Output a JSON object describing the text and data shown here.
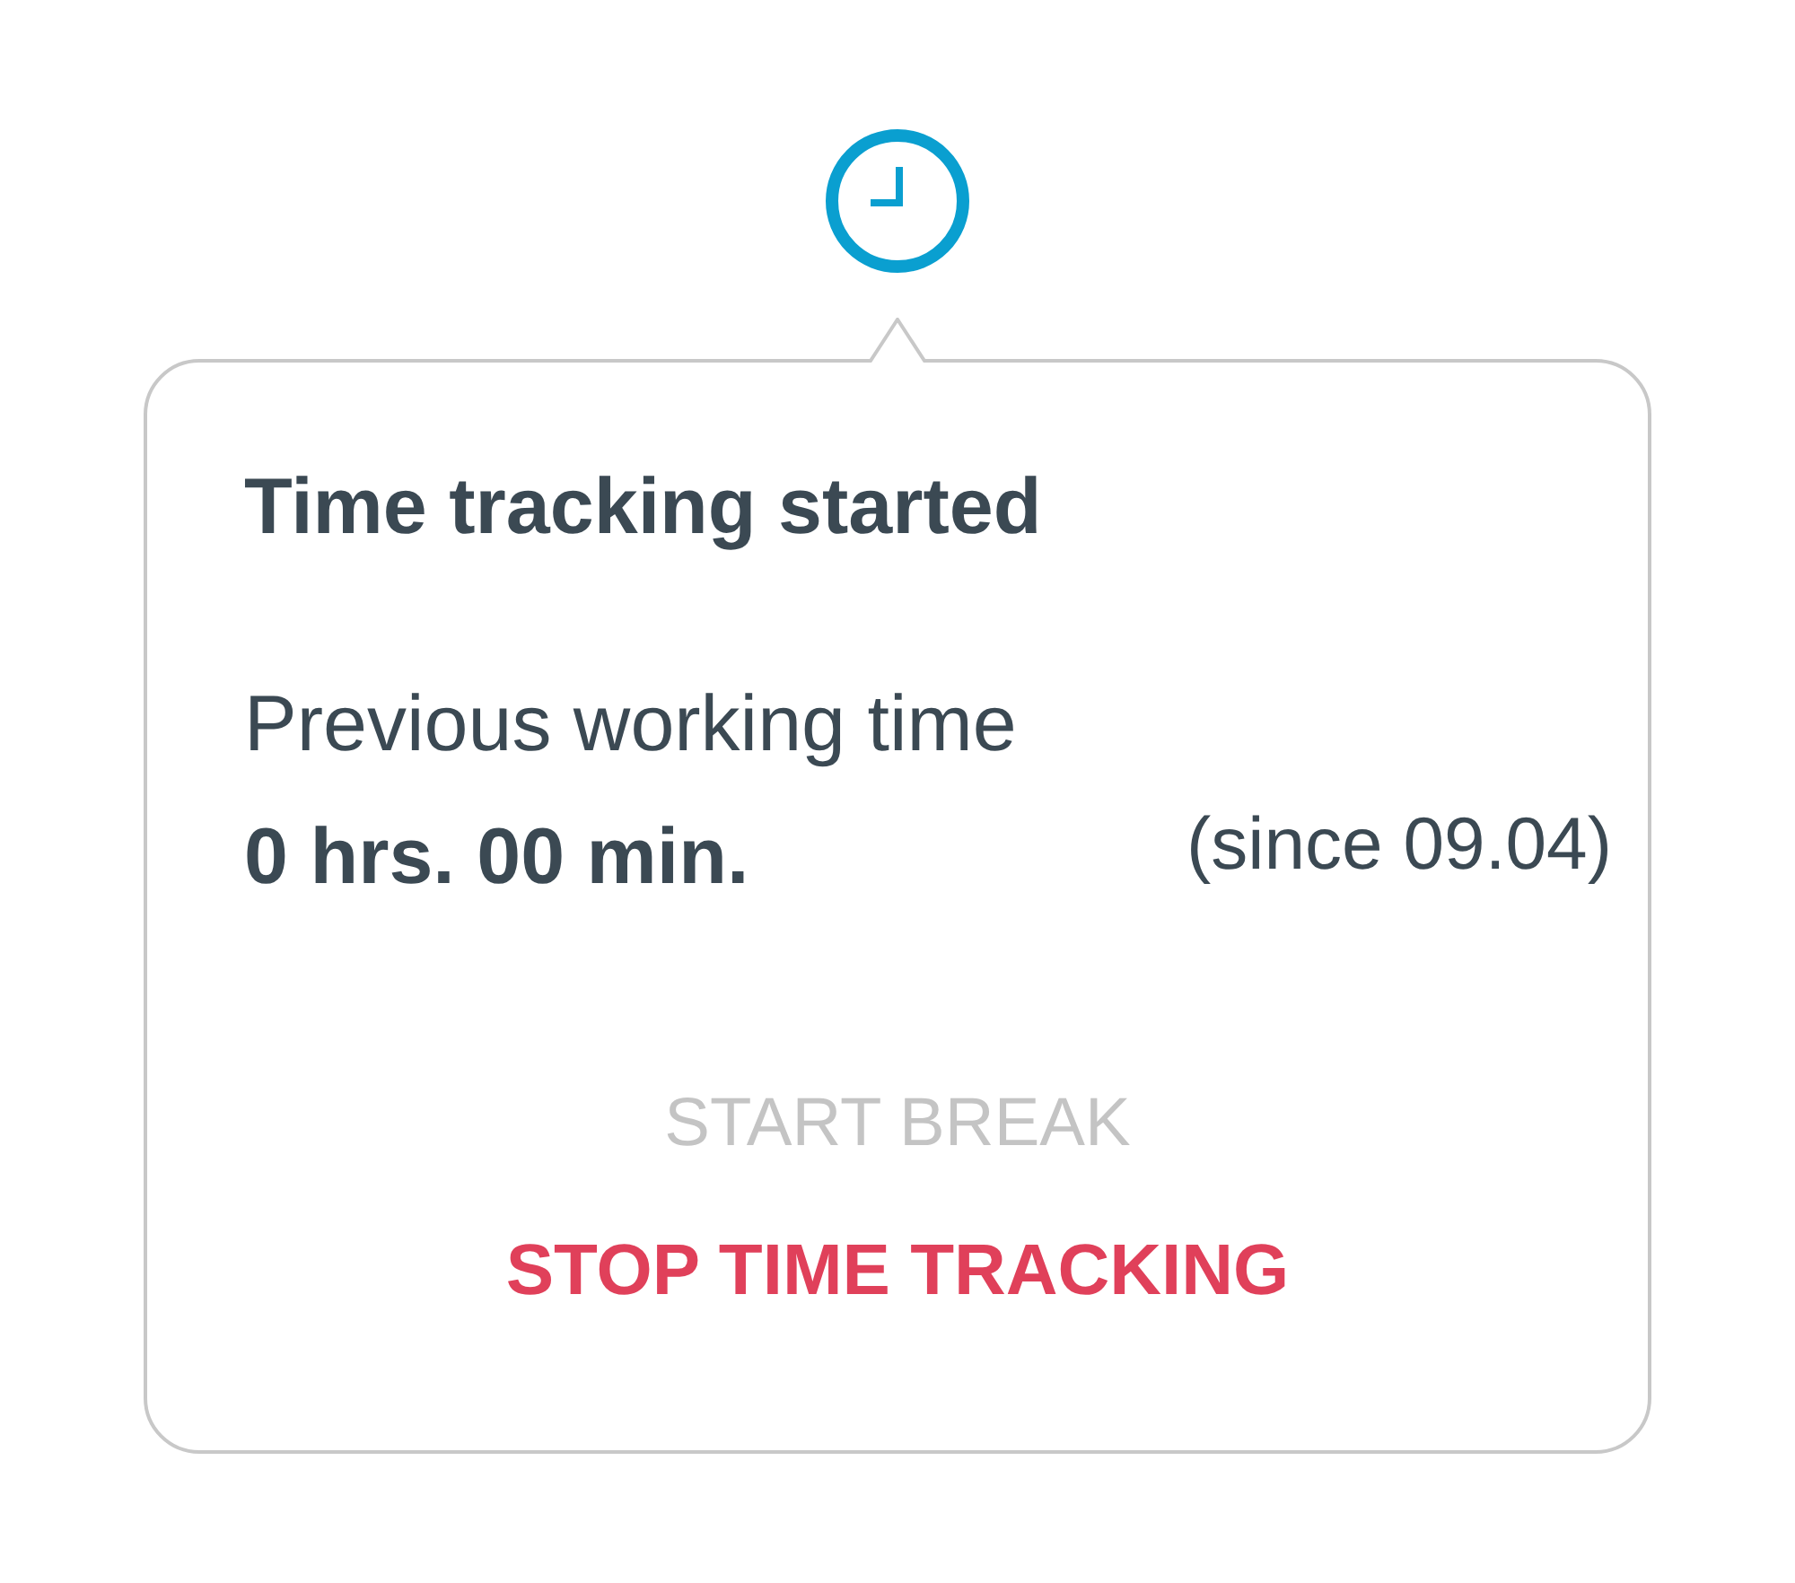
{
  "popover": {
    "title": "Time tracking started",
    "label": "Previous working time",
    "duration": "0 hrs. 00 min.",
    "since": "(since 09.04)",
    "actions": [
      {
        "label": "START BREAK",
        "disabled": true
      },
      {
        "label": "STOP TIME TRACKING",
        "disabled": false
      }
    ]
  }
}
